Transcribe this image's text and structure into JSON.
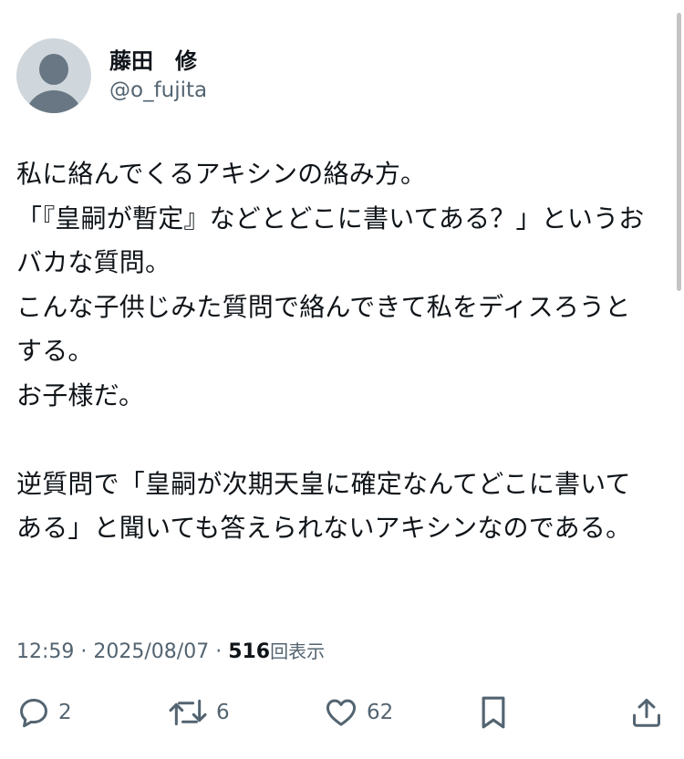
{
  "user": {
    "display_name": "藤田　修",
    "handle": "@o_fujita"
  },
  "tweet": {
    "text": "私に絡んでくるアキシンの絡み方。\n「『皇嗣が暫定』などとどこに書いてある？」というおバカな質問。\nこんな子供じみた質問で絡んできて私をディスろうとする。\nお子様だ。\n\n逆質問で「皇嗣が次期天皇に確定なんてどこに書いてある」と聞いても答えられないアキシンなのである。"
  },
  "meta": {
    "time": "12:59",
    "separator1": " · ",
    "date": "2025/08/07",
    "separator2": " · ",
    "view_count": "516",
    "views_label": "回表示"
  },
  "actions": {
    "reply_icon": "reply-icon",
    "reply_count": "2",
    "retweet_icon": "retweet-icon",
    "retweet_count": "6",
    "like_icon": "heart-icon",
    "like_count": "62",
    "bookmark_icon": "bookmark-icon",
    "share_icon": "share-icon"
  },
  "colors": {
    "text": "#0f1419",
    "secondary": "#536471",
    "avatar_bg": "#cfd6dc",
    "avatar_fg": "#687783"
  }
}
